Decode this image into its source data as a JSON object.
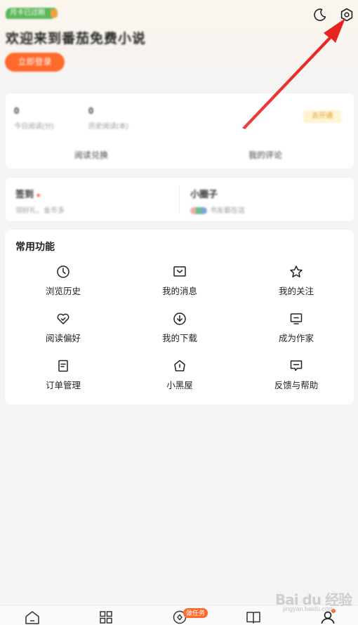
{
  "header": {
    "tag_label": "月卡已过期",
    "welcome_text": "欢迎来到番茄免费小说",
    "login_label": "立即登录"
  },
  "stats_card": {
    "stats": [
      {
        "value": "0",
        "label": "今日阅读(分)"
      },
      {
        "value": "0",
        "label": "历史阅读(本)"
      }
    ],
    "vip_label": "去开通",
    "actions": [
      "阅读兑换",
      "我的评论"
    ]
  },
  "row2_card": {
    "left": {
      "title": "签到",
      "subtitle": "领好礼，金币多"
    },
    "right": {
      "title": "小圈子",
      "subtitle": "书友都在这"
    }
  },
  "functions": {
    "title": "常用功能",
    "items": [
      {
        "label": "浏览历史",
        "icon": "clock-icon"
      },
      {
        "label": "我的消息",
        "icon": "message-icon"
      },
      {
        "label": "我的关注",
        "icon": "star-icon"
      },
      {
        "label": "阅读偏好",
        "icon": "heart-check-icon"
      },
      {
        "label": "我的下载",
        "icon": "download-icon"
      },
      {
        "label": "成为作家",
        "icon": "monitor-icon"
      },
      {
        "label": "订单管理",
        "icon": "order-icon"
      },
      {
        "label": "小黑屋",
        "icon": "house-icon"
      },
      {
        "label": "反馈与帮助",
        "icon": "feedback-icon"
      }
    ]
  },
  "tabbar": {
    "tabs": [
      "home-icon",
      "category-icon",
      "welfare-icon",
      "bookshelf-icon",
      "profile-icon"
    ],
    "badge": "做任务"
  },
  "watermark": {
    "text": "Bai du 经验",
    "sub": "jingyan.baidu.com"
  },
  "colors": {
    "accent": "#ff6a2c",
    "arrow": "#e8201d",
    "tag_green": "#5cb85c"
  }
}
